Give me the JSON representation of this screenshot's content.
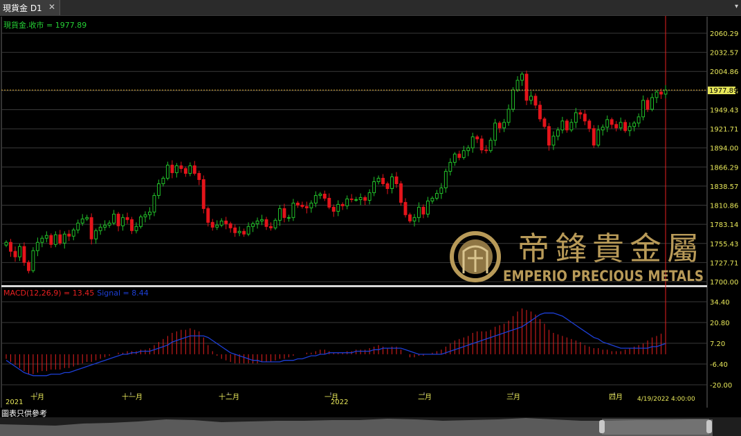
{
  "tab": {
    "title": "現貨金 D1",
    "close_icon": "close-icon",
    "menu_icon": "dropdown-arrow-icon"
  },
  "price_panel": {
    "label": "現貨金.收市 = 1977.89",
    "current_price": "1977.89",
    "current_price_line_value": 1977.89,
    "y_ticks": [
      "2060.29",
      "2032.57",
      "2004.86",
      "1977.14",
      "1949.43",
      "1921.71",
      "1894.00",
      "1866.29",
      "1838.57",
      "1810.86",
      "1783.14",
      "1755.43",
      "1727.71",
      "1700.00"
    ],
    "ylim": [
      1700.0,
      2060.29
    ]
  },
  "macd_panel": {
    "label_macd": "MACD(12,26,9) = 13.45",
    "label_signal": "Signal = 8.44",
    "y_ticks": [
      "34.40",
      "20.80",
      "7.20",
      "-6.40",
      "-20.00"
    ],
    "ylim": [
      -20.0,
      34.4
    ]
  },
  "x_axis": {
    "year_labels": [
      "2021",
      "2022"
    ],
    "month_labels": [
      "十月",
      "十一月",
      "十二月",
      "一月",
      "二月",
      "三月",
      "四月"
    ],
    "last_timestamp": "4/19/2022 4:00:00"
  },
  "watermark": {
    "chinese": "帝鋒貴金屬",
    "english": "EMPERIO PRECIOUS METALS"
  },
  "footer_note": "圖表只供參考",
  "colors": {
    "up": "#22c12a",
    "down": "#e3141b",
    "signal": "#1d3fd6",
    "price_line": "#d9a62c",
    "axis_text": "#e8e85a",
    "label_green": "#25d135",
    "label_red": "#e82020",
    "gold": "#b89a58"
  },
  "chart_data": [
    {
      "type": "candlestick",
      "title": "現貨金 D1",
      "series_close": [
        1757,
        1744,
        1736,
        1751,
        1728,
        1716,
        1745,
        1757,
        1763,
        1767,
        1754,
        1768,
        1756,
        1769,
        1766,
        1775,
        1785,
        1791,
        1793,
        1762,
        1774,
        1779,
        1782,
        1785,
        1798,
        1781,
        1793,
        1790,
        1774,
        1780,
        1794,
        1797,
        1801,
        1825,
        1842,
        1850,
        1869,
        1858,
        1868,
        1864,
        1857,
        1868,
        1857,
        1848,
        1806,
        1786,
        1779,
        1782,
        1788,
        1784,
        1778,
        1771,
        1773,
        1769,
        1780,
        1784,
        1788,
        1790,
        1780,
        1778,
        1789,
        1806,
        1793,
        1793,
        1814,
        1811,
        1809,
        1807,
        1814,
        1825,
        1827,
        1821,
        1808,
        1802,
        1812,
        1810,
        1820,
        1819,
        1819,
        1822,
        1818,
        1829,
        1845,
        1850,
        1842,
        1835,
        1852,
        1842,
        1815,
        1797,
        1788,
        1793,
        1808,
        1798,
        1817,
        1821,
        1828,
        1836,
        1860,
        1873,
        1885,
        1880,
        1890,
        1894,
        1910,
        1907,
        1891,
        1890,
        1905,
        1930,
        1923,
        1931,
        1950,
        1978,
        1992,
        2001,
        1963,
        1969,
        1956,
        1936,
        1925,
        1898,
        1911,
        1920,
        1933,
        1920,
        1931,
        1945,
        1943,
        1933,
        1922,
        1898,
        1920,
        1924,
        1935,
        1928,
        1923,
        1931,
        1919,
        1925,
        1930,
        1939,
        1963,
        1950,
        1967,
        1975,
        1972,
        1977.89
      ],
      "series_macd": [
        -3,
        -5,
        -7,
        -9,
        -11,
        -13,
        -13,
        -12,
        -11,
        -11,
        -10,
        -10,
        -10,
        -9,
        -9,
        -8,
        -7,
        -6,
        -5,
        -5,
        -4,
        -3,
        -2,
        -1,
        0,
        1,
        1,
        2,
        2,
        2,
        3,
        3,
        4,
        6,
        8,
        10,
        12,
        14,
        15,
        16,
        16,
        17,
        16,
        15,
        11,
        6,
        2,
        -1,
        -3,
        -4,
        -5,
        -6,
        -6,
        -6,
        -6,
        -6,
        -6,
        -5,
        -5,
        -5,
        -4,
        -3,
        -3,
        -2,
        -1,
        0,
        0,
        1,
        1,
        2,
        3,
        3,
        2,
        1,
        1,
        1,
        2,
        2,
        3,
        3,
        3,
        4,
        5,
        6,
        5,
        4,
        5,
        5,
        3,
        0,
        -2,
        -2,
        -1,
        -1,
        0,
        1,
        2,
        3,
        5,
        7,
        9,
        10,
        11,
        12,
        14,
        15,
        15,
        15,
        16,
        18,
        19,
        20,
        22,
        25,
        28,
        30,
        29,
        28,
        26,
        23,
        20,
        16,
        14,
        13,
        12,
        11,
        10,
        9,
        8,
        6,
        5,
        4,
        4,
        3,
        3,
        2,
        2,
        2,
        3,
        4,
        5,
        6,
        7,
        9,
        11,
        12,
        13.45
      ],
      "series_signal": [
        -4,
        -6,
        -8,
        -10,
        -12,
        -13,
        -14,
        -14,
        -14,
        -14,
        -13,
        -13,
        -13,
        -12,
        -12,
        -11,
        -10,
        -9,
        -8,
        -7,
        -6,
        -5,
        -4,
        -3,
        -2,
        -1,
        0,
        0,
        1,
        1,
        2,
        2,
        2,
        3,
        4,
        5,
        6,
        8,
        9,
        10,
        11,
        12,
        12,
        12,
        12,
        11,
        9,
        7,
        5,
        3,
        1,
        0,
        -1,
        -2,
        -3,
        -4,
        -4,
        -5,
        -5,
        -5,
        -5,
        -5,
        -4,
        -4,
        -4,
        -3,
        -3,
        -2,
        -1,
        -1,
        0,
        0,
        1,
        1,
        1,
        1,
        1,
        1,
        2,
        2,
        2,
        2,
        3,
        3,
        4,
        4,
        4,
        4,
        4,
        3,
        2,
        1,
        0,
        0,
        0,
        0,
        0,
        0,
        1,
        2,
        3,
        4,
        5,
        6,
        7,
        8,
        9,
        10,
        11,
        12,
        13,
        14,
        15,
        16,
        17,
        18,
        20,
        22,
        24,
        26,
        27,
        27,
        27,
        26,
        25,
        23,
        21,
        19,
        17,
        15,
        13,
        11,
        10,
        8,
        7,
        6,
        5,
        4,
        4,
        4,
        4,
        4,
        4,
        4,
        5,
        5,
        6,
        7,
        8,
        8.44
      ]
    }
  ]
}
